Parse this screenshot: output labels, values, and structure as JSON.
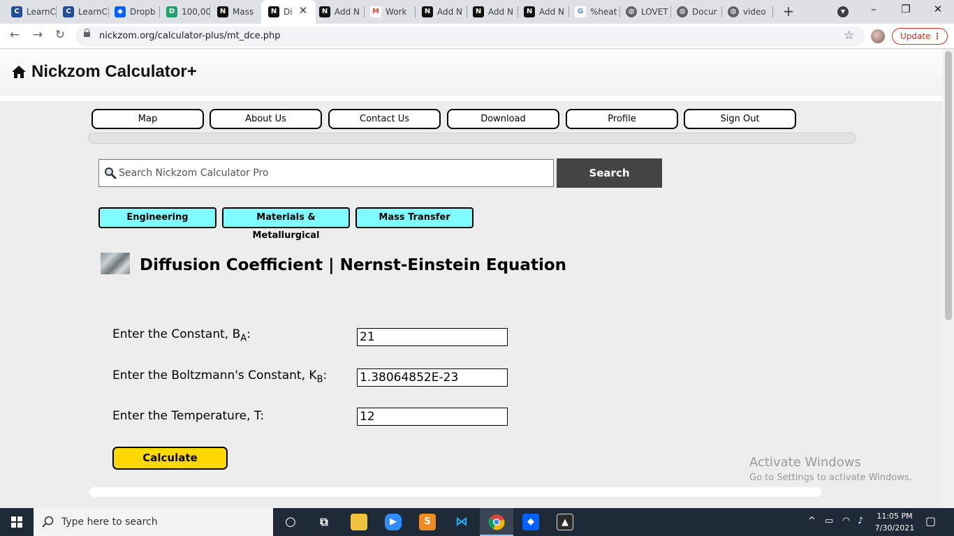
{
  "browser": {
    "tabs": [
      {
        "label": "LearnC",
        "icon": "learncpp-icon",
        "color": "#1f4e9b"
      },
      {
        "label": "LearnC",
        "icon": "learncpp-icon",
        "color": "#1f4e9b"
      },
      {
        "label": "Dropb",
        "icon": "dropbox-icon",
        "color": "#0061fe"
      },
      {
        "label": "100,00",
        "icon": "d-icon",
        "color": "#22a06b"
      },
      {
        "label": "Mass",
        "icon": "nickzom-icon",
        "color": "#111111"
      },
      {
        "label": "Di",
        "icon": "nickzom-icon",
        "color": "#111111",
        "active": true
      },
      {
        "label": "Add N",
        "icon": "nickzom-icon",
        "color": "#111111"
      },
      {
        "label": "Work",
        "icon": "gmail-icon",
        "color": "#ea4335"
      },
      {
        "label": "Add N",
        "icon": "nickzom-icon",
        "color": "#111111"
      },
      {
        "label": "Add N",
        "icon": "nickzom-icon",
        "color": "#111111"
      },
      {
        "label": "Add N",
        "icon": "nickzom-icon",
        "color": "#111111"
      },
      {
        "label": "%heat",
        "icon": "google-icon",
        "color": "#4285f4"
      },
      {
        "label": "LOVET",
        "icon": "globe-icon",
        "color": "#5f6368"
      },
      {
        "label": "Docur",
        "icon": "globe-icon",
        "color": "#5f6368"
      },
      {
        "label": "video",
        "icon": "globe-icon",
        "color": "#5f6368"
      }
    ],
    "url": "nickzom.org/calculator-plus/mt_dce.php",
    "update_label": "Update"
  },
  "site": {
    "brand": "Nickzom Calculator+",
    "menu": [
      "Map",
      "About Us",
      "Contact Us",
      "Download",
      "Profile",
      "Sign Out"
    ],
    "search": {
      "placeholder": "Search Nickzom Calculator Pro",
      "button": "Search"
    },
    "categories": [
      "Engineering",
      "Materials & Metallurgical",
      "Mass Transfer"
    ],
    "title": "Diffusion Coefficient | Nernst-Einstein Equation",
    "fields": [
      {
        "label": "Enter the Constant, B",
        "sub": "A",
        "suffix": ":",
        "value": "21"
      },
      {
        "label": "Enter the Boltzmann's Constant, K",
        "sub": "B",
        "suffix": ":",
        "value": "1.38064852E-23"
      },
      {
        "label": "Enter the Temperature, T:",
        "sub": "",
        "suffix": "",
        "value": "12"
      }
    ],
    "calculate": "Calculate"
  },
  "watermark": {
    "title": "Activate Windows",
    "subtitle": "Go to Settings to activate Windows."
  },
  "taskbar": {
    "search_text": "Type here to search",
    "time": "11:05 PM",
    "date": "7/30/2021"
  }
}
